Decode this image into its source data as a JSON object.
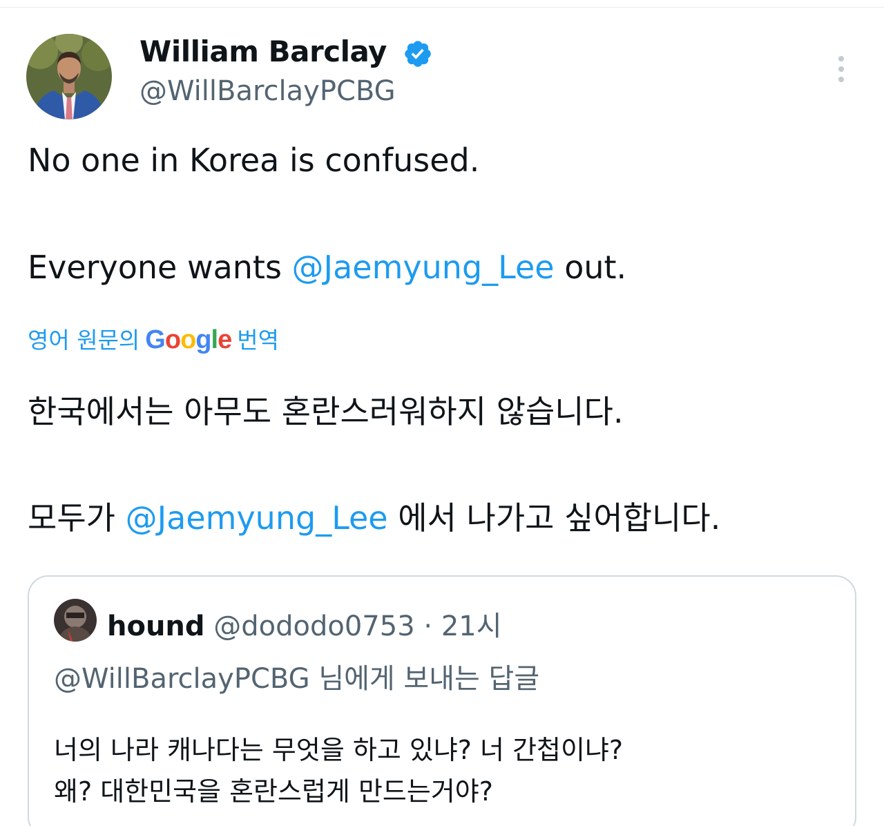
{
  "tweet": {
    "author": {
      "display_name": "William Barclay",
      "handle": "@WillBarclayPCBG",
      "verified": true,
      "verified_icon": "verified-badge-icon",
      "avatar": "profile-photo"
    },
    "more_icon": "more-options-icon",
    "lines": [
      {
        "text": "No one in Korea is confused."
      },
      {
        "before": "Everyone wants ",
        "mention": "@Jaemyung_Lee",
        "after": " out."
      }
    ],
    "translation_label": {
      "prefix": "영어 원문의",
      "brand": "Google",
      "suffix": "번역"
    },
    "translated_lines": [
      {
        "text": "한국에서는 아무도 혼란스러워하지 않습니다."
      },
      {
        "before": "모두가 ",
        "mention": "@Jaemyung_Lee",
        "after": " 에서 나가고 싶어합니다."
      }
    ]
  },
  "quoted_tweet": {
    "author_name": "hound",
    "handle": "@dododo0753",
    "separator": "·",
    "time": "21시",
    "reply_to": "@WillBarclayPCBG 님에게 보내는 답글",
    "lines": [
      "너의 나라 캐나다는 무엇을 하고 있냐? 너  간첩이냐?",
      "왜? 대한민국을 혼란스럽게 만드는거야?"
    ]
  },
  "colors": {
    "accent": "#1d9bf0",
    "text_primary": "#0f1419",
    "text_secondary": "#536471",
    "border": "#cfd9de",
    "google_blue": "#4285F4",
    "google_red": "#EA4335",
    "google_yellow": "#FBBC05",
    "google_green": "#34A853"
  }
}
